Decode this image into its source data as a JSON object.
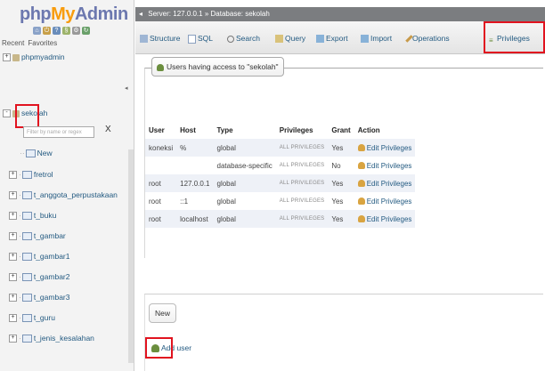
{
  "logo": {
    "part1": "php",
    "part2": "My",
    "part3": "Admin"
  },
  "sidebar": {
    "recent": "Recent",
    "favorites": "Favorites",
    "databases": [
      {
        "name": "phpmyadmin",
        "expander": "+"
      },
      {
        "name": "sekolah",
        "expander": "-"
      }
    ],
    "filter_placeholder": "Filter by name or regex",
    "filter_clear": "X",
    "new_label": "New",
    "tables": [
      "fretrol",
      "t_anggota_perpustakaan",
      "t_buku",
      "t_gambar",
      "t_gambar1",
      "t_gambar2",
      "t_gambar3",
      "t_guru",
      "t_jenis_kesalahan"
    ]
  },
  "topbar": {
    "server_label": "Server: 127.0.0.1",
    "database_label": "Database: sekolah"
  },
  "tabs": [
    {
      "label": "Structure",
      "icon": "structure-icon"
    },
    {
      "label": "SQL",
      "icon": "sql-icon"
    },
    {
      "label": "Search",
      "icon": "search-icon"
    },
    {
      "label": "Query",
      "icon": "query-icon"
    },
    {
      "label": "Export",
      "icon": "export-icon"
    },
    {
      "label": "Import",
      "icon": "import-icon"
    },
    {
      "label": "Operations",
      "icon": "operations-icon"
    },
    {
      "label": "Privileges",
      "icon": "privileges-icon"
    }
  ],
  "main": {
    "legend": "Users having access to \"sekolah\"",
    "columns": [
      "User",
      "Host",
      "Type",
      "Privileges",
      "Grant",
      "Action"
    ],
    "rows": [
      {
        "user": "koneksi",
        "host": "%",
        "type": "global",
        "privileges": "ALL PRIVILEGES",
        "grant": "Yes",
        "action": "Edit Privileges"
      },
      {
        "user": "",
        "host": "",
        "type": "database-specific",
        "privileges": "ALL PRIVILEGES",
        "grant": "No",
        "action": "Edit Privileges"
      },
      {
        "user": "root",
        "host": "127.0.0.1",
        "type": "global",
        "privileges": "ALL PRIVILEGES",
        "grant": "Yes",
        "action": "Edit Privileges"
      },
      {
        "user": "root",
        "host": "::1",
        "type": "global",
        "privileges": "ALL PRIVILEGES",
        "grant": "Yes",
        "action": "Edit Privileges"
      },
      {
        "user": "root",
        "host": "localhost",
        "type": "global",
        "privileges": "ALL PRIVILEGES",
        "grant": "Yes",
        "action": "Edit Privileges"
      }
    ],
    "new_legend": "New",
    "add_user": "Add user"
  },
  "colors": {
    "highlight": "#e1131f",
    "link": "#235a81",
    "logo_blue": "#6c78af",
    "logo_orange": "#f89c0e",
    "topbar": "#7b7d80"
  }
}
